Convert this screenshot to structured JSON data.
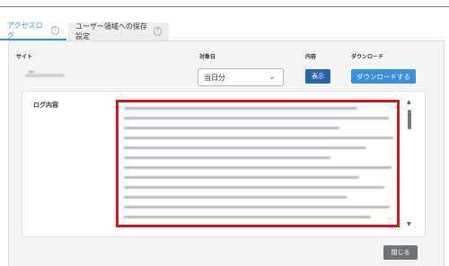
{
  "tabs": [
    {
      "label": "アクセスログ"
    },
    {
      "label": "ユーザー領域への保存設定"
    }
  ],
  "help_glyph": "?",
  "headers": {
    "site": "サイト",
    "target_date": "対象日",
    "content": "内容",
    "download": "ダウンロード"
  },
  "filter": {
    "date_selected": "当日分",
    "chevron": "⌄"
  },
  "buttons": {
    "show": "表示",
    "download": "ダウンロードする",
    "close": "閉じる"
  },
  "log": {
    "label": "ログ内容"
  },
  "scroll": {
    "up": "▲",
    "down": "▼"
  },
  "colors": {
    "accent": "#3a8fdc",
    "show_button": "#2a64ab",
    "highlight_border": "#d8141e",
    "close_button": "#6f7276"
  }
}
